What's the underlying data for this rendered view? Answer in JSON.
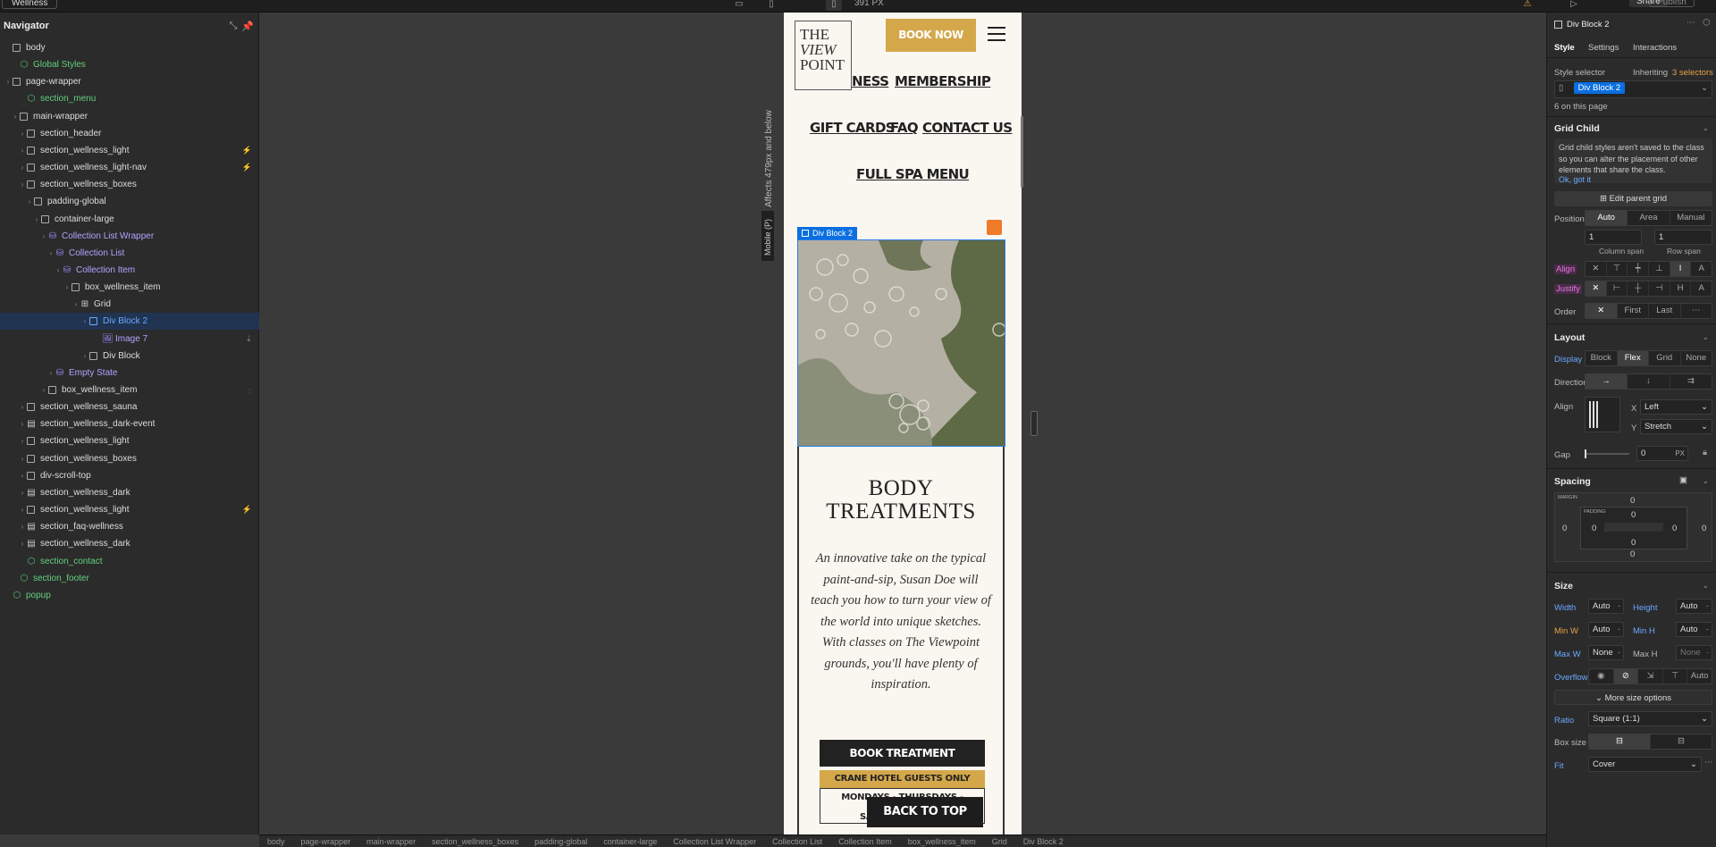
{
  "topbar": {
    "project": "Wellness",
    "width_readout": "391 PX",
    "share": "Share",
    "publish": "Publish"
  },
  "navigator": {
    "title": "Navigator",
    "rows": [
      {
        "label": "body",
        "type": "box",
        "color": "white",
        "depth": 0
      },
      {
        "label": "Global Styles",
        "type": "comp",
        "color": "green",
        "depth": 1
      },
      {
        "label": "page-wrapper",
        "type": "box",
        "color": "white",
        "depth": 0,
        "caret": true
      },
      {
        "label": "section_menu",
        "type": "comp",
        "color": "green",
        "depth": 2
      },
      {
        "label": "main-wrapper",
        "type": "box",
        "color": "white",
        "depth": 1,
        "caret": true
      },
      {
        "label": "section_header",
        "type": "box",
        "color": "white",
        "depth": 2,
        "caret": true
      },
      {
        "label": "section_wellness_light",
        "type": "box",
        "color": "white",
        "depth": 2,
        "caret": true,
        "trail": "⚡"
      },
      {
        "label": "section_wellness_light-nav",
        "type": "box",
        "color": "white",
        "depth": 2,
        "caret": true,
        "trail": "⚡"
      },
      {
        "label": "section_wellness_boxes",
        "type": "box",
        "color": "white",
        "depth": 2,
        "caret": true
      },
      {
        "label": "padding-global",
        "type": "box",
        "color": "white",
        "depth": 3,
        "caret": true
      },
      {
        "label": "container-large",
        "type": "box",
        "color": "white",
        "depth": 4,
        "caret": true
      },
      {
        "label": "Collection List Wrapper",
        "type": "cms",
        "color": "purple",
        "depth": 5,
        "caret": true
      },
      {
        "label": "Collection List",
        "type": "cms",
        "color": "purple",
        "depth": 6,
        "caret": true
      },
      {
        "label": "Collection Item",
        "type": "cms",
        "color": "purple",
        "depth": 7,
        "caret": true
      },
      {
        "label": "box_wellness_item",
        "type": "box",
        "color": "white",
        "depth": 8,
        "caret": true
      },
      {
        "label": "Grid",
        "type": "grid",
        "color": "white",
        "depth": 9,
        "caret": true
      },
      {
        "label": "Div Block 2",
        "type": "box",
        "color": "blue",
        "depth": 10,
        "caret": true,
        "selected": true
      },
      {
        "label": "Image 7",
        "type": "img",
        "color": "purple",
        "depth": 11,
        "trail": "⇣"
      },
      {
        "label": "Div Block",
        "type": "box",
        "color": "white",
        "depth": 10,
        "caret": true
      },
      {
        "label": "Empty State",
        "type": "cms",
        "color": "purple",
        "depth": 6,
        "caret": true
      },
      {
        "label": "box_wellness_item",
        "type": "box",
        "color": "white",
        "depth": 5,
        "caret": true,
        "trail": "◌"
      },
      {
        "label": "section_wellness_sauna",
        "type": "box",
        "color": "white",
        "depth": 2,
        "caret": true
      },
      {
        "label": "section_wellness_dark-event",
        "type": "sec",
        "color": "white",
        "depth": 2,
        "caret": true
      },
      {
        "label": "section_wellness_light",
        "type": "box",
        "color": "white",
        "depth": 2,
        "caret": true
      },
      {
        "label": "section_wellness_boxes",
        "type": "box",
        "color": "white",
        "depth": 2,
        "caret": true
      },
      {
        "label": "div-scroll-top",
        "type": "box",
        "color": "white",
        "depth": 2,
        "caret": true
      },
      {
        "label": "section_wellness_dark",
        "type": "sec",
        "color": "white",
        "depth": 2,
        "caret": true
      },
      {
        "label": "section_wellness_light",
        "type": "box",
        "color": "white",
        "depth": 2,
        "caret": true,
        "trail": "⚡"
      },
      {
        "label": "section_faq-wellness",
        "type": "sec",
        "color": "white",
        "depth": 2,
        "caret": true
      },
      {
        "label": "section_wellness_dark",
        "type": "sec",
        "color": "white",
        "depth": 2,
        "caret": true
      },
      {
        "label": "section_contact",
        "type": "comp",
        "color": "green",
        "depth": 2
      },
      {
        "label": "section_footer",
        "type": "comp",
        "color": "green",
        "depth": 1
      },
      {
        "label": "popup",
        "type": "comp",
        "color": "green",
        "depth": 0
      }
    ]
  },
  "canvas": {
    "affects_label": "Affects 479px and below",
    "breakpoint_tag": "Mobile (P)",
    "logo": {
      "line1": "THE",
      "line2": "VIEW",
      "line3": "POINT"
    },
    "book_now": "BOOK NOW",
    "menu": {
      "row1a": "NESS",
      "row1b": "MEMBERSHIP",
      "gift": "GIFT CARDS",
      "faq": "FAQ",
      "contact": "CONTACT US",
      "full": "FULL SPA MENU"
    },
    "selected_tag": "Div Block 2",
    "card": {
      "title_l1": "BODY",
      "title_l2": "TREATMENTS",
      "description": "An innovative take on the typical paint-and-sip, Susan Doe will teach you how to turn your view of the world into unique sketches. With classes on The Viewpoint grounds, you'll have plenty of inspiration.",
      "book_treatment": "BOOK TREATMENT",
      "crane": "CRANE HOTEL GUESTS ONLY",
      "days_l1": "MONDAYS - THURSDAYS - FRIDAYS",
      "days_l2": "SA"
    },
    "back_to_top": "BACK TO TOP"
  },
  "breadcrumbs": [
    "body",
    "page-wrapper",
    "main-wrapper",
    "section_wellness_boxes",
    "padding-global",
    "container-large",
    "Collection List Wrapper",
    "Collection List",
    "Collection Item",
    "box_wellness_item",
    "Grid",
    "Div Block 2"
  ],
  "panel": {
    "element": "Div Block 2",
    "tabs": [
      "Style",
      "Settings",
      "Interactions"
    ],
    "style_selector": "Style selector",
    "inheriting": "Inheriting",
    "selectors_count": "3 selectors",
    "selector_chip": "Div Block 2",
    "on_page": "6 on this page",
    "grid_child": {
      "title": "Grid Child",
      "note": "Grid child styles aren't saved to the class so you can alter the placement of other elements that share the class.",
      "ok": "Ok, got it",
      "edit_parent": "Edit parent grid",
      "position": "Position",
      "pos_opts": [
        "Auto",
        "Area",
        "Manual"
      ],
      "col_span_val": "1",
      "row_span_val": "1",
      "col_span": "Column span",
      "row_span": "Row span",
      "align": "Align",
      "justify": "Justify",
      "order": "Order",
      "order_opts": [
        "First",
        "Last"
      ]
    },
    "layout": {
      "title": "Layout",
      "display": "Display",
      "display_opts": [
        "Block",
        "Flex",
        "Grid",
        "None"
      ],
      "direction": "Direction",
      "align": "Align",
      "x": "X",
      "x_val": "Left",
      "y": "Y",
      "y_val": "Stretch",
      "gap": "Gap",
      "gap_val": "0",
      "gap_unit": "PX"
    },
    "spacing": {
      "title": "Spacing",
      "margin": "MARGIN",
      "padding": "PADDING",
      "zero": "0"
    },
    "size": {
      "title": "Size",
      "width": "Width",
      "height": "Height",
      "minw": "Min W",
      "minh": "Min H",
      "maxw": "Max W",
      "maxh": "Max H",
      "auto": "Auto",
      "none": "None",
      "overflow": "Overflow",
      "overflow_auto": "Auto",
      "more": "More size options",
      "ratio": "Ratio",
      "ratio_val": "Square (1:1)",
      "box_size": "Box size",
      "fit": "Fit",
      "fit_val": "Cover"
    }
  }
}
